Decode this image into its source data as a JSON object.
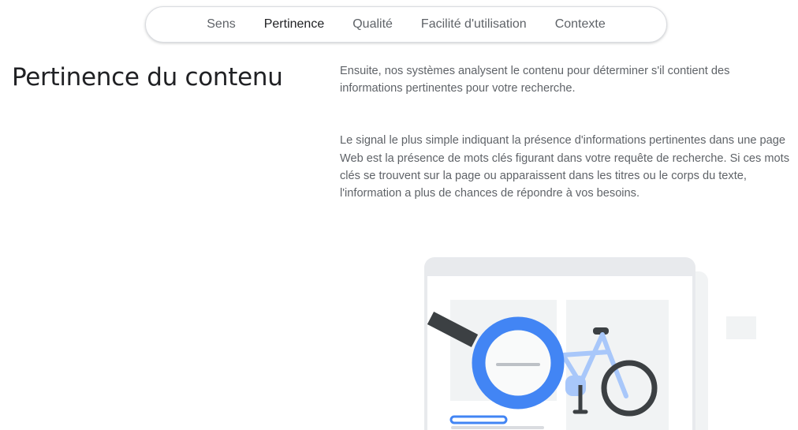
{
  "tabs": [
    {
      "label": "Sens",
      "active": false
    },
    {
      "label": "Pertinence",
      "active": true
    },
    {
      "label": "Qualité",
      "active": false
    },
    {
      "label": "Facilité d'utilisation",
      "active": false
    },
    {
      "label": "Contexte",
      "active": false
    }
  ],
  "section": {
    "title": "Pertinence du contenu",
    "paragraphs": [
      "Ensuite, nos systèmes analysent le contenu pour déterminer s'il contient des informations pertinentes pour votre recherche.",
      "Le signal le plus simple indiquant la présence d'informations pertinentes dans une page Web est la présence de mots clés figurant dans votre requête de recherche. Si ces mots clés se trouvent sur la page ou apparaissent dans les titres ou le corps du texte, l'information a plus de chances de répondre à vos besoins."
    ]
  },
  "illustration": {
    "subject": "magnifying glass over web page with bicycle",
    "colors": {
      "frame": "#e8eaed",
      "panel": "#f1f3f4",
      "lens_ring": "#4285f4",
      "handle": "#3c4043",
      "bike_frame": "#a8c7fa",
      "wheel": "#3c4043",
      "link_bar": "#4285f4"
    }
  }
}
